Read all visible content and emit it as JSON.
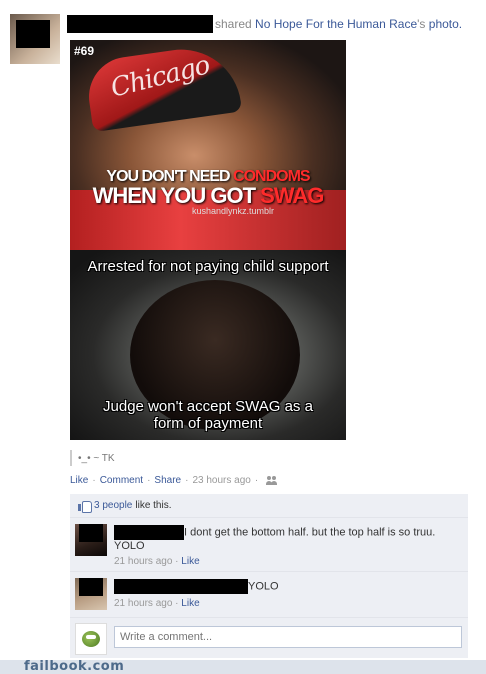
{
  "story": {
    "action_text": "shared",
    "page_name": "No Hope For the Human Race",
    "possessive": "'s",
    "object": "photo."
  },
  "photo": {
    "number_tag": "#69",
    "hat_text": "Chicago",
    "caption_line1_white": "YOU DON'T NEED ",
    "caption_line1_red": "CONDOMS",
    "caption_line2_white": "WHEN YOU GOT ",
    "caption_line2_red": "SWAG",
    "watermark": "kushandlynkz.tumblr",
    "caption_top_bottom_panel": "Arrested for not paying child support",
    "caption_bottom_line1": "Judge won't accept SWAG as a",
    "caption_bottom_line2": "form of payment"
  },
  "photo_caption": "•_• ~ TK",
  "actions": {
    "like": "Like",
    "sep": "·",
    "comment": "Comment",
    "share": "Share",
    "time": "23 hours ago"
  },
  "likes": {
    "count_link": "3 people",
    "suffix": "like this."
  },
  "comments": [
    {
      "text": "I dont get the bottom half. but the top half is so truu.",
      "text_line2": "YOLO",
      "time": "21 hours ago",
      "like": "Like"
    },
    {
      "text": "YOLO",
      "time": "21 hours ago",
      "like": "Like"
    }
  ],
  "composer": {
    "placeholder": "Write a comment..."
  },
  "footer": {
    "brand": "failbook.com"
  },
  "colors": {
    "link": "#3b5998",
    "ufi_background": "#edeff4",
    "footer_background": "#dde3eb"
  }
}
